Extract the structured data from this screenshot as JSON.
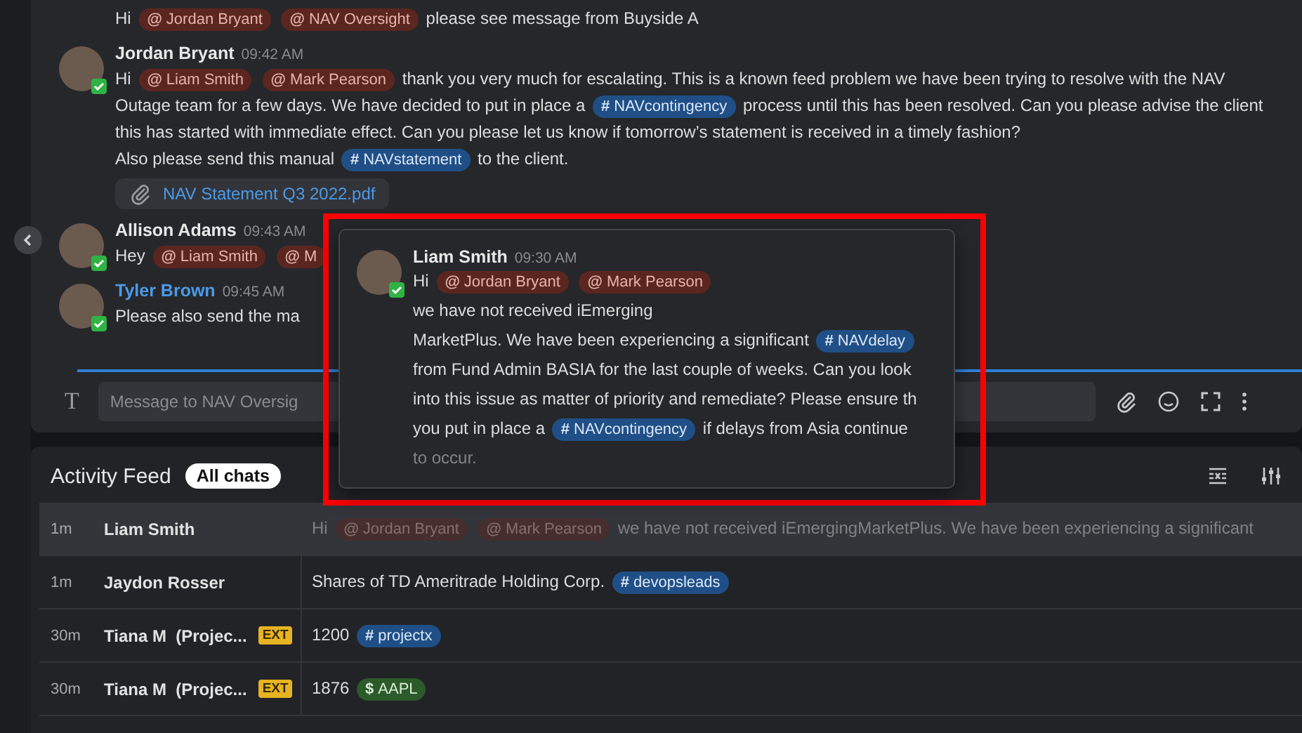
{
  "chat": {
    "messages": [
      {
        "parts": [
          {
            "kind": "text",
            "text": "Hi"
          },
          {
            "kind": "mention",
            "symbol": "@",
            "text": "Jordan Bryant"
          },
          {
            "kind": "mention",
            "symbol": "@",
            "text": "NAV Oversight"
          },
          {
            "kind": "text",
            "text": "please see message from Buyside A"
          }
        ]
      },
      {
        "author": "Jordan Bryant",
        "time": "09:42 AM",
        "verified": true,
        "linked": false,
        "parts": [
          {
            "kind": "text",
            "text": "Hi"
          },
          {
            "kind": "mention",
            "symbol": "@",
            "text": "Liam Smith"
          },
          {
            "kind": "mention",
            "symbol": "@",
            "text": "Mark Pearson"
          },
          {
            "kind": "text",
            "text": "thank you very much for escalating. This is a known feed problem we have been trying to resolve with the NAV Outage team for a few days. We have decided to put in place a"
          },
          {
            "kind": "channel",
            "symbol": "#",
            "text": "NAVcontingency"
          },
          {
            "kind": "text",
            "text": "process until this has been resolved. Can you please advise the client this has started with immediate effect. Can you please let us know if tomorrow’s statement is received in a timely fashion?"
          },
          {
            "kind": "break"
          },
          {
            "kind": "text",
            "text": "Also please send this manual"
          },
          {
            "kind": "channel",
            "symbol": "#",
            "text": "NAVstatement"
          },
          {
            "kind": "text",
            "text": "to the client."
          }
        ],
        "attachment": "NAV Statement Q3 2022.pdf"
      },
      {
        "author": "Allison Adams",
        "time": "09:43 AM",
        "verified": true,
        "linked": false,
        "parts": [
          {
            "kind": "text",
            "text": "Hey"
          },
          {
            "kind": "mention",
            "symbol": "@",
            "text": "Liam Smith"
          },
          {
            "kind": "mention",
            "symbol": "@",
            "text": "M"
          }
        ]
      },
      {
        "author": "Tyler Brown",
        "time": "09:45 AM",
        "verified": true,
        "linked": true,
        "parts": [
          {
            "kind": "text",
            "text": "Please also send the ma"
          }
        ]
      }
    ],
    "composer": {
      "format_label": "T",
      "placeholder": "Message to NAV Oversig"
    }
  },
  "feed": {
    "title": "Activity Feed",
    "filter": "All chats",
    "rows": [
      {
        "time": "1m",
        "name": "Liam Smith",
        "external": false,
        "selected": true,
        "parts": [
          {
            "kind": "text",
            "text": "Hi"
          },
          {
            "kind": "mention",
            "symbol": "@",
            "text": "Jordan Bryant"
          },
          {
            "kind": "mention",
            "symbol": "@",
            "text": "Mark Pearson"
          },
          {
            "kind": "text",
            "text": "we have not received iEmergingMarketPlus. We have been experiencing a significant"
          }
        ]
      },
      {
        "time": "1m",
        "name": "Jaydon Rosser",
        "external": false,
        "selected": false,
        "parts": [
          {
            "kind": "text",
            "text": "Shares of TD Ameritrade Holding Corp."
          },
          {
            "kind": "channel",
            "symbol": "#",
            "text": "devopsleads"
          }
        ]
      },
      {
        "time": "30m",
        "name": "Tiana M  (Projec...",
        "external": true,
        "badge": "EXT",
        "selected": false,
        "parts": [
          {
            "kind": "text",
            "text": "1200"
          },
          {
            "kind": "channel",
            "symbol": "#",
            "text": "projectx"
          }
        ]
      },
      {
        "time": "30m",
        "name": "Tiana M  (Projec...",
        "external": true,
        "badge": "EXT",
        "selected": false,
        "parts": [
          {
            "kind": "text",
            "text": "1876"
          },
          {
            "kind": "ticker",
            "symbol": "$",
            "text": "AAPL"
          }
        ]
      }
    ]
  },
  "preview": {
    "author": "Liam Smith",
    "time": "09:30 AM",
    "verified": true,
    "lines": [
      {
        "faded": false,
        "parts": [
          {
            "kind": "text",
            "text": "Hi"
          },
          {
            "kind": "mention",
            "symbol": "@",
            "text": "Jordan Bryant"
          },
          {
            "kind": "mention",
            "symbol": "@",
            "text": "Mark Pearson"
          }
        ]
      },
      {
        "faded": false,
        "parts": [
          {
            "kind": "text",
            "text": "we have not received iEmerging"
          }
        ]
      },
      {
        "faded": false,
        "parts": [
          {
            "kind": "text",
            "text": "MarketPlus. We have been experiencing a  significant"
          },
          {
            "kind": "channel",
            "symbol": "#",
            "text": "NAVdelay"
          }
        ]
      },
      {
        "faded": false,
        "parts": [
          {
            "kind": "text",
            "text": "from Fund Admin BASIA for the last couple of weeks. Can you look"
          }
        ]
      },
      {
        "faded": false,
        "parts": [
          {
            "kind": "text",
            "text": "into this issue as matter  of priority and remediate? Please ensure th"
          }
        ]
      },
      {
        "faded": false,
        "parts": [
          {
            "kind": "text",
            "text": "you put in place a"
          },
          {
            "kind": "channel",
            "symbol": "#",
            "text": "NAVcontingency"
          },
          {
            "kind": "text",
            "text": "if delays from Asia continue"
          }
        ]
      },
      {
        "faded": true,
        "parts": [
          {
            "kind": "text",
            "text": "to occur."
          }
        ]
      }
    ]
  }
}
